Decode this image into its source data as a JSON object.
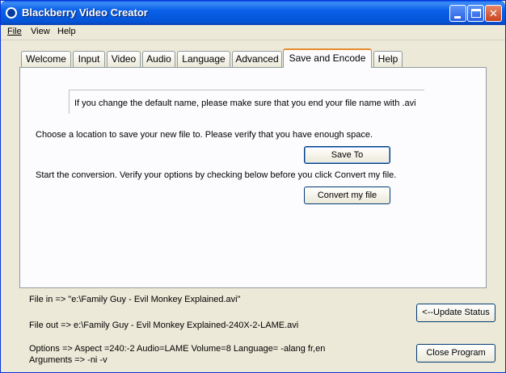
{
  "window": {
    "title": "Blackberry Video Creator"
  },
  "menu": {
    "file": "File",
    "view": "View",
    "help": "Help"
  },
  "tabs": [
    {
      "label": "Welcome"
    },
    {
      "label": "Input"
    },
    {
      "label": "Video"
    },
    {
      "label": "Audio"
    },
    {
      "label": "Language"
    },
    {
      "label": "Advanced"
    },
    {
      "label": "Save and Encode"
    },
    {
      "label": "Help"
    }
  ],
  "active_tab": "Save and Encode",
  "panel": {
    "info": "If you change the default name, please make sure that you end your file name with .avi",
    "choose_location": "Choose a location to save your new file to. Please verify that you have enough space.",
    "save_to_label": "Save To",
    "start_conversion": "Start the conversion. Verify your options by checking below before you click Convert my file.",
    "convert_label": "Convert my file"
  },
  "status": {
    "file_in": "File in =>   \"e:\\Family Guy - Evil Monkey Explained.avi\"",
    "file_out": "File out =>  e:\\Family Guy - Evil Monkey Explained-240X-2-LAME.avi",
    "options": "Options =>  Aspect =240:-2   Audio=LAME   Volume=8    Language= -alang fr,en",
    "arguments": "Arguments =>   -ni -v"
  },
  "buttons": {
    "update_status": "<--Update Status",
    "close_program": "Close Program"
  }
}
